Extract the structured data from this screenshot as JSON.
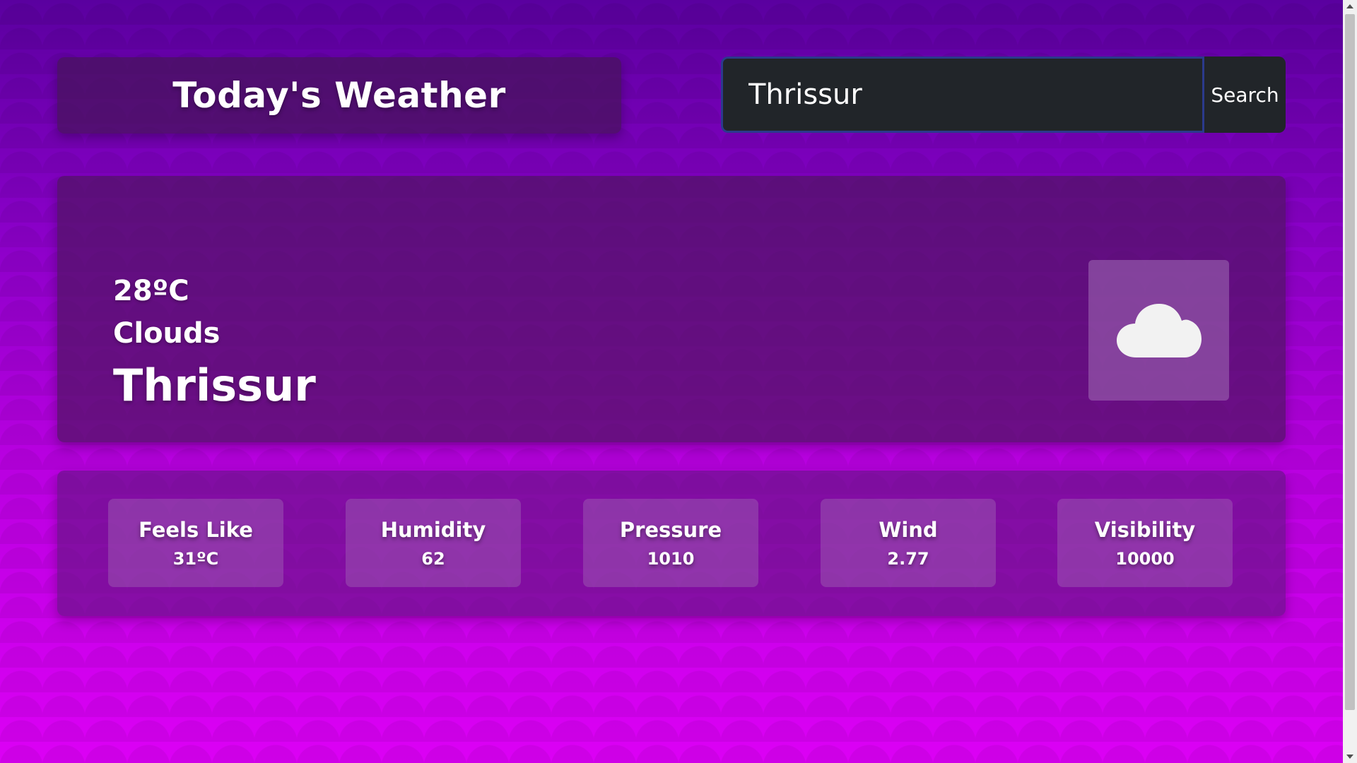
{
  "header": {
    "title": "Today's Weather"
  },
  "search": {
    "value": "Thrissur",
    "button_label": "Search"
  },
  "current": {
    "temperature": "28ºC",
    "condition": "Clouds",
    "city": "Thrissur",
    "icon": "cloud-icon"
  },
  "details": [
    {
      "label": "Feels Like",
      "value": "31ºC"
    },
    {
      "label": "Humidity",
      "value": "62"
    },
    {
      "label": "Pressure",
      "value": "1010"
    },
    {
      "label": "Wind",
      "value": "2.77"
    },
    {
      "label": "Visibility",
      "value": "10000"
    }
  ],
  "colors": {
    "background_top": "#5a009f",
    "background_bottom": "#dc00f5",
    "search_bg": "#212529",
    "focus_border": "#2b3a8c"
  }
}
